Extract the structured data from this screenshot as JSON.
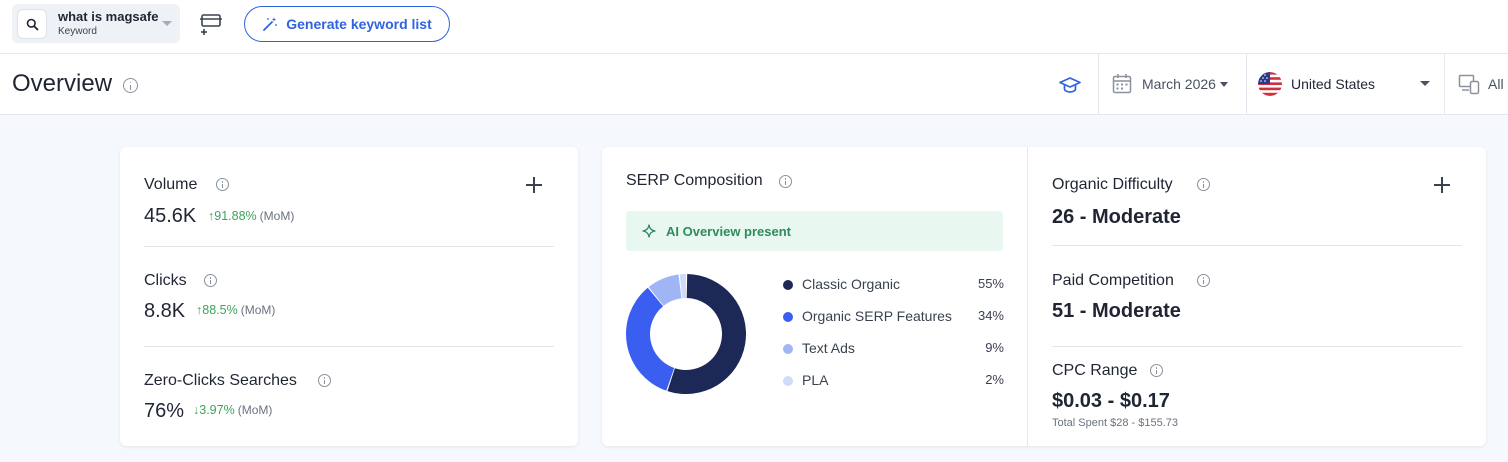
{
  "topbar": {
    "keyword": "what is magsafe",
    "keyword_type": "Keyword",
    "generate_label": "Generate keyword list"
  },
  "header": {
    "title": "Overview",
    "date": "March 2026",
    "country": "United States",
    "device": "All"
  },
  "metrics_left": {
    "volume": {
      "label": "Volume",
      "value": "45.6K",
      "trend": "↑91.88%",
      "period": "(MoM)"
    },
    "clicks": {
      "label": "Clicks",
      "value": "8.8K",
      "trend": "↑88.5%",
      "period": "(MoM)"
    },
    "zero_clicks": {
      "label": "Zero-Clicks Searches",
      "value": "76%",
      "trend": "↓3.97%",
      "period": "(MoM)"
    }
  },
  "serp": {
    "title": "SERP Composition",
    "ai_overview": "AI Overview present",
    "segments": [
      {
        "name": "Classic Organic",
        "pct_label": "55%",
        "value": 55,
        "color": "#1c2856"
      },
      {
        "name": "Organic SERP Features",
        "pct_label": "34%",
        "value": 34,
        "color": "#3a5ef0"
      },
      {
        "name": "Text Ads",
        "pct_label": "9%",
        "value": 9,
        "color": "#9fb5f5"
      },
      {
        "name": "PLA",
        "pct_label": "2%",
        "value": 2,
        "color": "#cddcf8"
      }
    ]
  },
  "metrics_right": {
    "organic_difficulty": {
      "label": "Organic Difficulty",
      "value": "26 - Moderate"
    },
    "paid_competition": {
      "label": "Paid Competition",
      "value": "51 - Moderate"
    },
    "cpc_range": {
      "label": "CPC Range",
      "value": "$0.03 - $0.17",
      "note": "Total Spent $28 - $155.73"
    }
  },
  "colors": {
    "accent": "#2f63e0",
    "positive": "#3aa55a",
    "ai_banner_bg": "#e9f7f1",
    "ai_banner_text": "#2f8a5f"
  },
  "icons": [
    "search-icon",
    "list-add-icon",
    "magic-wand-icon",
    "info-icon",
    "graduation-cap-icon",
    "calendar-icon",
    "us-flag-icon",
    "devices-icon",
    "plus-icon",
    "sparkle-icon"
  ]
}
